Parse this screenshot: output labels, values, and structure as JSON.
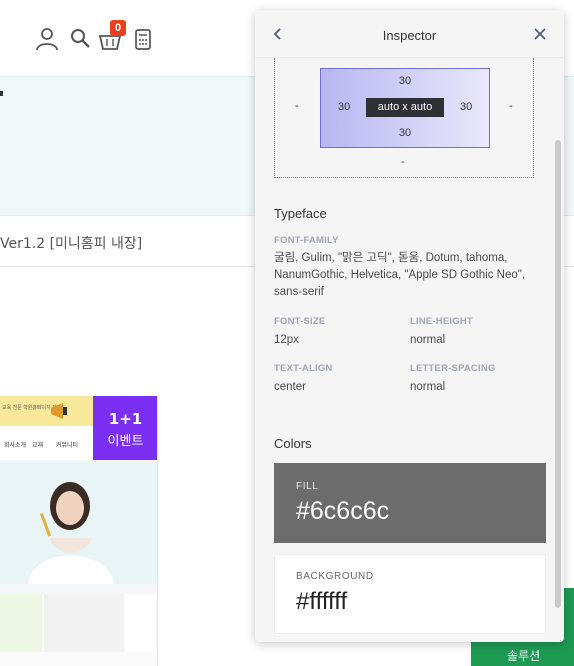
{
  "site": {
    "cart_count": "0",
    "product_title": "Ver1.2 [미니홈피 내장]",
    "thumbnail": {
      "top_note": "교육 전문 학원홈페이지 제작",
      "nav": [
        "회사소개",
        "교재",
        "커뮤니티"
      ],
      "event_line1": "1+1",
      "event_line2": "이벤트"
    },
    "solution_button": "솔루션"
  },
  "inspector": {
    "title": "Inspector",
    "box_model": {
      "margin_left": "-",
      "margin_right": "-",
      "margin_bottom": "-",
      "padding_top": "30",
      "padding_right": "30",
      "padding_bottom": "30",
      "padding_left": "30",
      "content": "auto x auto"
    },
    "typeface": {
      "title": "Typeface",
      "font_family_label": "FONT-FAMILY",
      "font_family_lines": [
        "굴림, Gulim, \"맑은 고딕\", 돋움, Dotum, tahoma,",
        "NanumGothic, Helvetica, \"Apple SD Gothic Neo\",",
        "sans-serif"
      ],
      "font_size_label": "FONT-SIZE",
      "font_size": "12px",
      "line_height_label": "LINE-HEIGHT",
      "line_height": "normal",
      "text_align_label": "TEXT-ALIGN",
      "text_align": "center",
      "letter_spacing_label": "LETTER-SPACING",
      "letter_spacing": "normal"
    },
    "colors": {
      "title": "Colors",
      "fill_label": "FILL",
      "fill": "#6c6c6c",
      "background_label": "BACKGROUND",
      "background": "#ffffff"
    }
  },
  "icons": {
    "user": "user-icon",
    "search": "search-icon",
    "cart": "cart-icon",
    "calculator": "calculator-icon",
    "back": "chevron-left-icon",
    "close": "close-icon"
  }
}
